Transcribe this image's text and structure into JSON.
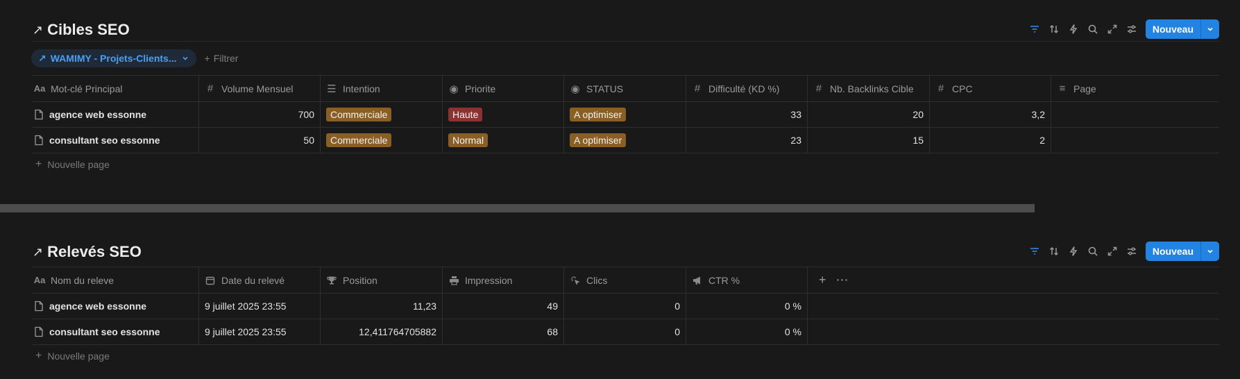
{
  "cibles": {
    "title": "Cibles SEO",
    "new_label": "Nouveau",
    "view_label": "WAMIMY - Projets-Clients...",
    "filter_label": "Filtrer",
    "columns": [
      "Mot-clé Principal",
      "Volume Mensuel",
      "Intention",
      "Priorite",
      "STATUS",
      "Difficulté (KD %)",
      "Nb. Backlinks Cible",
      "CPC",
      "Page"
    ],
    "rows": [
      {
        "name": "agence web essonne",
        "volume": "700",
        "intention": "Commerciale",
        "priorite": "Haute",
        "status": "A optimiser",
        "kd": "33",
        "backlinks": "20",
        "cpc": "3,2"
      },
      {
        "name": "consultant seo essonne",
        "volume": "50",
        "intention": "Commerciale",
        "priorite": "Normal",
        "status": "A optimiser",
        "kd": "23",
        "backlinks": "15",
        "cpc": "2"
      }
    ],
    "add_page": "Nouvelle page"
  },
  "releves": {
    "title": "Relevés SEO",
    "new_label": "Nouveau",
    "columns": [
      "Nom du releve",
      "Date du relevé",
      "Position",
      "Impression",
      "Clics",
      "CTR %"
    ],
    "rows": [
      {
        "name": "agence web essonne",
        "date": "9 juillet 2025 23:55",
        "position": "11,23",
        "impression": "49",
        "clics": "0",
        "ctr": "0 %"
      },
      {
        "name": "consultant seo essonne",
        "date": "9 juillet 2025 23:55",
        "position": "12,411764705882",
        "impression": "68",
        "clics": "0",
        "ctr": "0 %"
      }
    ],
    "add_page": "Nouvelle page"
  },
  "colors": {
    "accent": "#2383e2",
    "tag_brown": "#8a5f26",
    "tag_red": "#8b3232"
  }
}
